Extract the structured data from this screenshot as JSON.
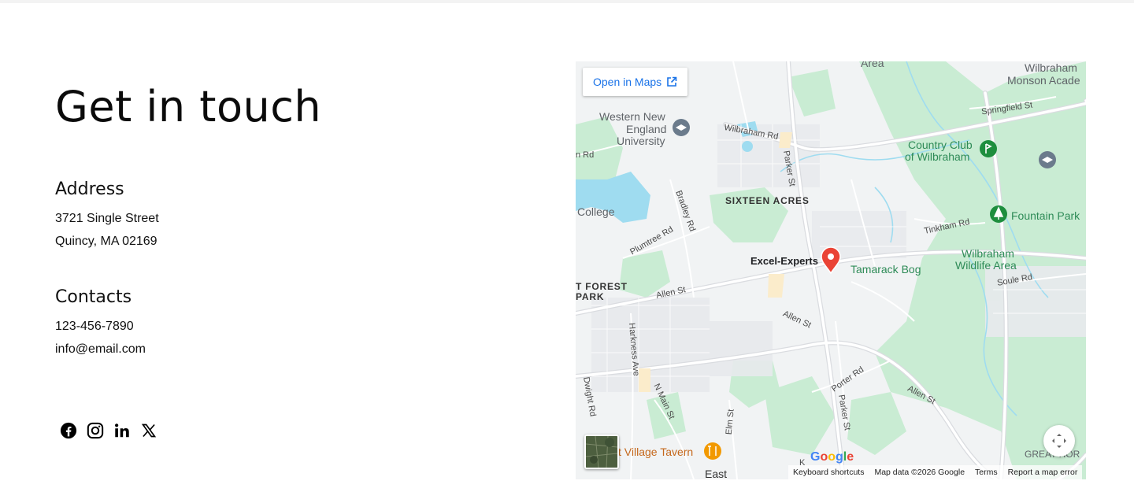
{
  "title": "Get in touch",
  "address": {
    "heading": "Address",
    "line1": "3721 Single Street",
    "line2": "Quincy, MA 02169"
  },
  "contacts": {
    "heading": "Contacts",
    "phone": "123-456-7890",
    "email": "info@email.com"
  },
  "socials": [
    "facebook-icon",
    "instagram-icon",
    "linkedin-icon",
    "x-icon"
  ],
  "map": {
    "open_in_maps": "Open in Maps",
    "marker_label": "Excel-Experts",
    "labels": {
      "area_top": "Area",
      "wilbraham_monson": "Wilbraham",
      "monson_acad": "Monson Acade",
      "springfield_st": "Springfield St",
      "western_new": "Western New",
      "england": "England",
      "university": "University",
      "wilbraham_rd": "Wilbraham Rd",
      "parker_st_top": "Parker St",
      "country_club": "Country Club",
      "of_wilbraham": "of Wilbraham",
      "n_rd": "n Rd",
      "bradley_rd": "Bradley Rd",
      "sixteen_acres": "SIXTEEN ACRES",
      "college": "College",
      "plumtree_rd": "Plumtree Rd",
      "fountain_park": "Fountain Park",
      "tinkham_rd": "Tinkham Rd",
      "tamarack_bog": "Tamarack Bog",
      "wilbraham_wildlife_1": "Wilbraham",
      "wilbraham_wildlife_2": "Wildlife Area",
      "soule_rd": "Soule Rd",
      "forest_1": "T FOREST",
      "forest_2": "PARK",
      "allen_st_1": "Allen St",
      "allen_st_2": "Allen St",
      "allen_st_3": "Allen St",
      "harkness_ave": "Harkness Ave",
      "porter_rd": "Porter Rd",
      "parker_st_bottom": "Parker St",
      "dwight_rd": "Dwight Rd",
      "n_main_st": "N Main St",
      "elm_st": "Elm St",
      "village_tavern": "t Village Tavern",
      "east": "East",
      "greathorn": "GREAT HOR",
      "k": "K"
    },
    "attribution": {
      "google": "Google",
      "keyboard": "Keyboard shortcuts",
      "map_data": "Map data ©2026 Google",
      "terms": "Terms",
      "report": "Report a map error"
    },
    "colors": {
      "park": "#c9ecd3",
      "water": "#9fdcf0",
      "road": "#ffffff",
      "marker": "#ea4335",
      "link": "#1a73e8"
    }
  }
}
